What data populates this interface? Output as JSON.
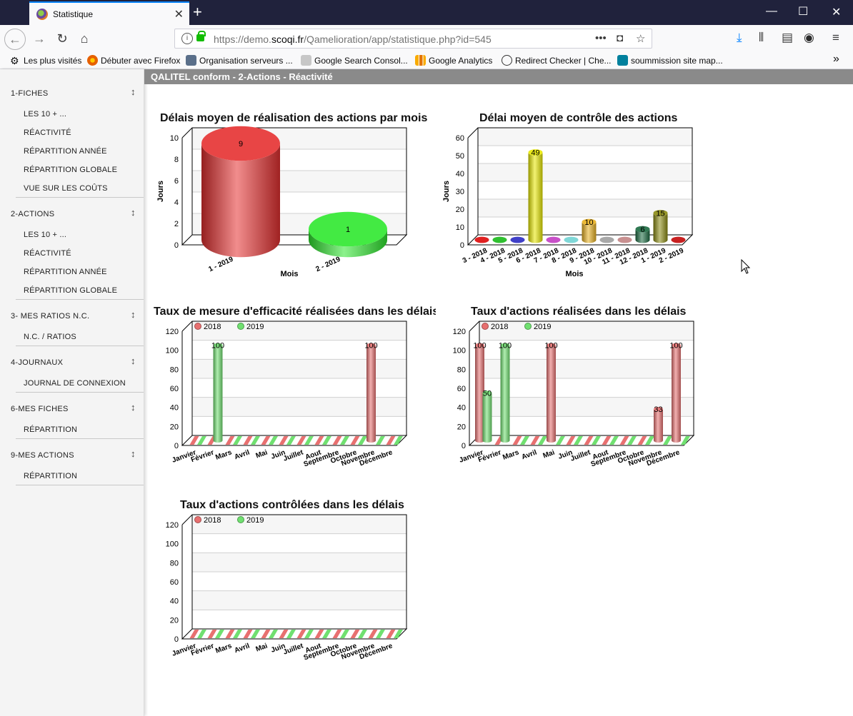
{
  "browser": {
    "tab_title": "Statistique",
    "url_prefix": "https://demo.",
    "url_domain": "scoqi.fr",
    "url_path": "/Qamelioration/app/statistique.php?id=545",
    "bookmarks": [
      "Les plus visités",
      "Débuter avec Firefox",
      "Organisation serveurs ...",
      "Google Search Consol...",
      "Google Analytics",
      "Redirect Checker | Che...",
      "soummission site map..."
    ]
  },
  "page": {
    "header": "QALITEL conform - 2-Actions - Réactivité"
  },
  "sidebar": {
    "sections": [
      {
        "title": "1-FICHES",
        "items": [
          "LES 10 + ...",
          "RÉACTIVITÉ",
          "RÉPARTITION ANNÉE",
          "RÉPARTITION GLOBALE",
          "VUE SUR LES COÛTS"
        ]
      },
      {
        "title": "2-ACTIONS",
        "items": [
          "LES 10 + ...",
          "RÉACTIVITÉ",
          "RÉPARTITION ANNÉE",
          "RÉPARTITION GLOBALE"
        ]
      },
      {
        "title": "3- MES RATIOS N.C.",
        "items": [
          "N.C. / RATIOS"
        ]
      },
      {
        "title": "4-JOURNAUX",
        "items": [
          "JOURNAL DE CONNEXION"
        ]
      },
      {
        "title": "6-MES FICHES",
        "items": [
          "RÉPARTITION"
        ]
      },
      {
        "title": "9-MES ACTIONS",
        "items": [
          "RÉPARTITION"
        ]
      }
    ]
  },
  "chart_data": [
    {
      "type": "bar",
      "title": "Délais moyen de réalisation des actions par mois",
      "xlabel": "Mois",
      "ylabel": "Jours",
      "ylim": [
        0,
        10
      ],
      "yticks": [
        0,
        2,
        4,
        6,
        8,
        10
      ],
      "categories": [
        "1 - 2019",
        "2 - 2019"
      ],
      "values": [
        9,
        1
      ],
      "colors": [
        "#e53030",
        "#2ee82e"
      ]
    },
    {
      "type": "bar",
      "title": "Délai moyen de contrôle des actions",
      "xlabel": "Mois",
      "ylabel": "Jours",
      "ylim": [
        0,
        60
      ],
      "yticks": [
        0,
        10,
        20,
        30,
        40,
        50,
        60
      ],
      "categories": [
        "3 - 2018",
        "4 - 2018",
        "5 - 2018",
        "6 - 2018",
        "7 - 2018",
        "8 - 2018",
        "9 - 2018",
        "10 - 2018",
        "11 - 2018",
        "12 - 2018",
        "1 - 2019",
        "2 - 2019"
      ],
      "values": [
        0,
        0,
        0,
        49,
        0,
        0,
        10,
        0,
        0,
        6,
        15,
        0
      ],
      "labels": [
        "",
        "",
        "",
        "49",
        "",
        "",
        "10",
        "",
        "",
        "6",
        "15",
        ""
      ],
      "colors": [
        "#e02020",
        "#30c030",
        "#4040c8",
        "#e8e800",
        "#c850c8",
        "#80d8d8",
        "#e8b020",
        "#a8a8a8",
        "#c89090",
        "#1a6a40",
        "#8a8a10",
        "#c82020"
      ]
    },
    {
      "type": "bar",
      "title": "Taux de mesure d'efficacité réalisées dans les délais",
      "ylim": [
        0,
        120
      ],
      "yticks": [
        0,
        20,
        40,
        60,
        80,
        100,
        120
      ],
      "categories": [
        "Janvier",
        "Février",
        "Mars",
        "Avril",
        "Mai",
        "Juin",
        "Juillet",
        "Aout",
        "Septembre",
        "Octobre",
        "Novembre",
        "Décembre"
      ],
      "series": [
        {
          "name": "2018",
          "color": "#e87070",
          "values": [
            0,
            0,
            0,
            0,
            0,
            0,
            0,
            0,
            0,
            0,
            100,
            0
          ]
        },
        {
          "name": "2019",
          "color": "#70e070",
          "values": [
            0,
            100,
            0,
            0,
            0,
            0,
            0,
            0,
            0,
            0,
            0,
            0
          ]
        }
      ]
    },
    {
      "type": "bar",
      "title": "Taux d'actions réalisées dans les délais",
      "ylim": [
        0,
        120
      ],
      "yticks": [
        0,
        20,
        40,
        60,
        80,
        100,
        120
      ],
      "categories": [
        "Janvier",
        "Février",
        "Mars",
        "Avril",
        "Mai",
        "Juin",
        "Juillet",
        "Aout",
        "Septembre",
        "Octobre",
        "Novembre",
        "Décembre"
      ],
      "series": [
        {
          "name": "2018",
          "color": "#e87070",
          "values": [
            100,
            0,
            0,
            0,
            100,
            0,
            0,
            0,
            0,
            0,
            33,
            100
          ]
        },
        {
          "name": "2019",
          "color": "#70e070",
          "values": [
            50,
            100,
            0,
            0,
            0,
            0,
            0,
            0,
            0,
            0,
            0,
            0
          ]
        }
      ]
    },
    {
      "type": "bar",
      "title": "Taux d'actions contrôlées dans les délais",
      "ylim": [
        0,
        120
      ],
      "yticks": [
        0,
        20,
        40,
        60,
        80,
        100,
        120
      ],
      "categories": [
        "Janvier",
        "Février",
        "Mars",
        "Avril",
        "Mai",
        "Juin",
        "Juillet",
        "Aout",
        "Septembre",
        "Octobre",
        "Novembre",
        "Décembre"
      ],
      "series": [
        {
          "name": "2018",
          "color": "#e87070",
          "values": [
            0,
            0,
            0,
            0,
            0,
            0,
            0,
            0,
            0,
            0,
            0,
            0
          ]
        },
        {
          "name": "2019",
          "color": "#70e070",
          "values": [
            0,
            0,
            0,
            0,
            0,
            0,
            0,
            0,
            0,
            0,
            0,
            0
          ]
        }
      ]
    }
  ]
}
